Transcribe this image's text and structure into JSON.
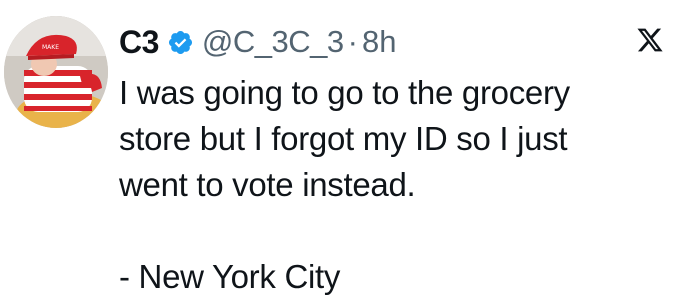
{
  "tweet": {
    "author": {
      "display_name": "C3",
      "handle": "@C_3C_3",
      "verified_icon": "verified-badge-icon"
    },
    "separator": "·",
    "time": "8h",
    "platform_logo": "x-logo-icon",
    "text_lines": [
      "I was going to go to the grocery",
      "store but I forgot my ID so I just",
      "went to vote instead."
    ],
    "signature": "- New York City"
  },
  "colors": {
    "text": "#0f1419",
    "muted": "#536471",
    "verified": "#1d9bf0"
  }
}
